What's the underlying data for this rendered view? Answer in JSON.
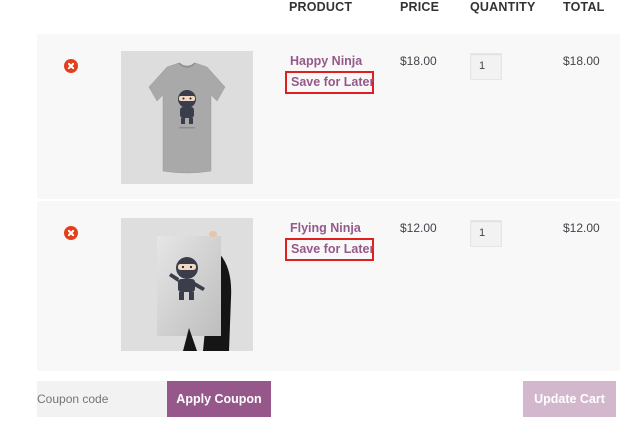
{
  "table": {
    "headers": {
      "product": "PRODUCT",
      "price": "PRICE",
      "quantity": "QUANTITY",
      "total": "TOTAL"
    },
    "items": [
      {
        "name": "Happy Ninja",
        "save_label": "Save for Later",
        "price": "$18.00",
        "quantity": "1",
        "total": "$18.00",
        "image_icon": "tshirt-ninja-image"
      },
      {
        "name": "Flying Ninja",
        "save_label": "Save for Later",
        "price": "$12.00",
        "quantity": "1",
        "total": "$12.00",
        "image_icon": "poster-ninja-image"
      }
    ]
  },
  "actions": {
    "coupon_placeholder": "Coupon code",
    "apply_label": "Apply Coupon",
    "update_label": "Update Cart"
  },
  "colors": {
    "brand": "#96588a",
    "remove": "#e2401c",
    "highlight": "#e02020",
    "update_disabled": "#d3b7cc"
  }
}
